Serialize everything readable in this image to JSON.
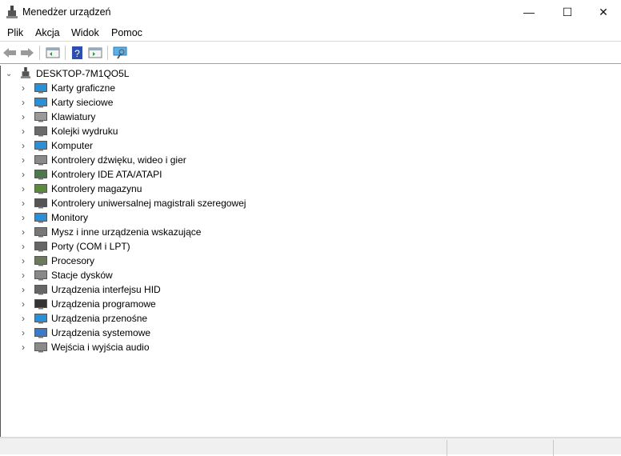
{
  "window": {
    "title": "Menedżer urządzeń",
    "minimize": "—",
    "maximize": "☐",
    "close": "✕"
  },
  "menu": [
    "Plik",
    "Akcja",
    "Widok",
    "Pomoc"
  ],
  "toolbar": [
    "back",
    "forward",
    "show-hide-console-tree",
    "help",
    "properties",
    "scan-hardware"
  ],
  "tree": {
    "root": "DESKTOP-7M1QO5L",
    "items": [
      {
        "label": "Karty graficzne",
        "color": "#2b8fd8"
      },
      {
        "label": "Karty sieciowe",
        "color": "#2b8fd8"
      },
      {
        "label": "Klawiatury",
        "color": "#9a9a9a"
      },
      {
        "label": "Kolejki wydruku",
        "color": "#6b6b6b"
      },
      {
        "label": "Komputer",
        "color": "#2b8fd8"
      },
      {
        "label": "Kontrolery dźwięku, wideo i gier",
        "color": "#8a8a8a"
      },
      {
        "label": "Kontrolery IDE ATA/ATAPI",
        "color": "#4a7a4a"
      },
      {
        "label": "Kontrolery magazynu",
        "color": "#5a8a3a"
      },
      {
        "label": "Kontrolery uniwersalnej magistrali szeregowej",
        "color": "#555555"
      },
      {
        "label": "Monitory",
        "color": "#2b8fd8"
      },
      {
        "label": "Mysz i inne urządzenia wskazujące",
        "color": "#777777"
      },
      {
        "label": "Porty (COM i LPT)",
        "color": "#666666"
      },
      {
        "label": "Procesory",
        "color": "#6a7a5a"
      },
      {
        "label": "Stacje dysków",
        "color": "#888888"
      },
      {
        "label": "Urządzenia interfejsu HID",
        "color": "#666666"
      },
      {
        "label": "Urządzenia programowe",
        "color": "#333333"
      },
      {
        "label": "Urządzenia przenośne",
        "color": "#2b8fd8"
      },
      {
        "label": "Urządzenia systemowe",
        "color": "#3a7ac8"
      },
      {
        "label": "Wejścia i wyjścia audio",
        "color": "#8a8a8a"
      }
    ]
  }
}
